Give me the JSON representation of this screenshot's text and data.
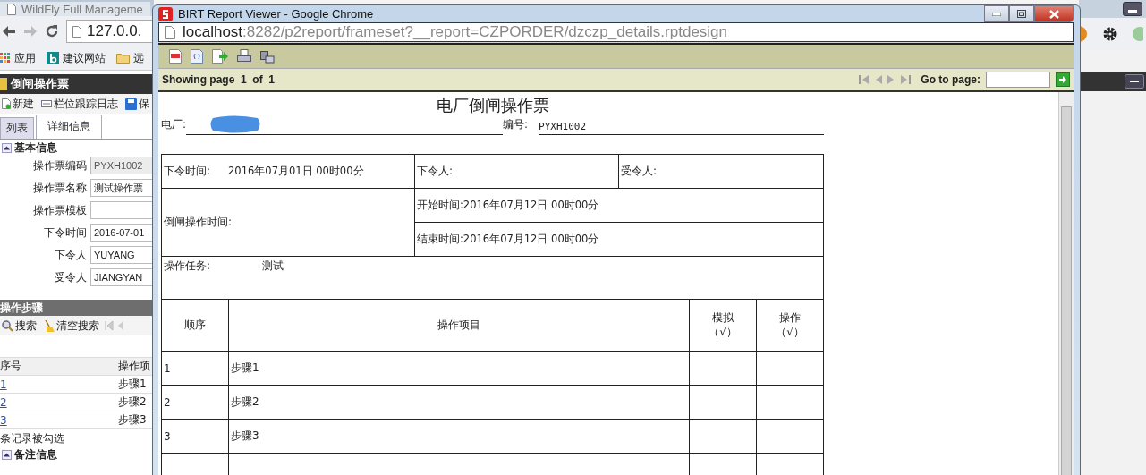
{
  "background_browser": {
    "tab_title": "WildFly Full Manageme",
    "address": "127.0.0.",
    "bookmarks": [
      "应用",
      "建议网站",
      "远"
    ]
  },
  "app": {
    "title": "倒闸操作票",
    "toolbar": [
      "新建",
      "栏位跟踪日志",
      "保"
    ],
    "tabs": [
      {
        "label": "列表",
        "selected": false
      },
      {
        "label": "详细信息",
        "selected": true
      }
    ],
    "basic_section": {
      "title": "基本信息",
      "expanded": true,
      "fields": [
        {
          "label": "操作票编码",
          "value": "PYXH1002",
          "disabled": true
        },
        {
          "label": "操作票名称",
          "value": "测试操作票",
          "disabled": false
        },
        {
          "label": "操作票模板",
          "disabled": false
        },
        {
          "label": "下令时间",
          "value": "2016-07-01",
          "disabled": false
        },
        {
          "label": "下令人",
          "value": "YUYANG",
          "disabled": false
        },
        {
          "label": "受令人",
          "value": "JIANGYAN",
          "disabled": false
        }
      ]
    },
    "steps_section": {
      "title": "操作步骤",
      "toolbar": [
        "搜索",
        "清空搜索"
      ],
      "columns": [
        "序号",
        "操作项"
      ],
      "rows": [
        [
          "1",
          "步骤1"
        ],
        [
          "2",
          "步骤2"
        ],
        [
          "3",
          "步骤3"
        ]
      ],
      "status": "条记录被勾选"
    },
    "remarks_section": {
      "title": "备注信息",
      "expanded": true
    }
  },
  "popup": {
    "title": "BIRT Report Viewer - Google Chrome",
    "address": {
      "host": "localhost",
      "path": ":8282/p2report/frameset?__report=CZPORDER/dzczp_details.rptdesign"
    },
    "page_status": "Showing page  1  of  1",
    "goto_label": "Go to page:",
    "report": {
      "title": "电厂倒闸操作票",
      "plant_label": "电厂:",
      "number_label": "编号:",
      "number": "PYXH1002",
      "order_time_label": "下令时间:",
      "order_time": "2016年07月01日 00时00分",
      "issuer_label": "下令人:",
      "receiver_label": "受令人:",
      "op_time_label": "倒闸操作时间:",
      "start_time": "开始时间:2016年07月12日 00时00分",
      "end_time": "结束时间:2016年07月12日 00时00分",
      "task_label": "操作任务:",
      "task": "测试",
      "columns": [
        {
          "title": "顺序"
        },
        {
          "title": "操作项目"
        },
        {
          "title": "模拟",
          "note": "（√）"
        },
        {
          "title": "操作",
          "note": "（√）"
        }
      ],
      "rows": [
        {
          "seq": "1",
          "item": "步骤1"
        },
        {
          "seq": "2",
          "item": "步骤2"
        },
        {
          "seq": "3",
          "item": "步骤3"
        }
      ]
    }
  }
}
